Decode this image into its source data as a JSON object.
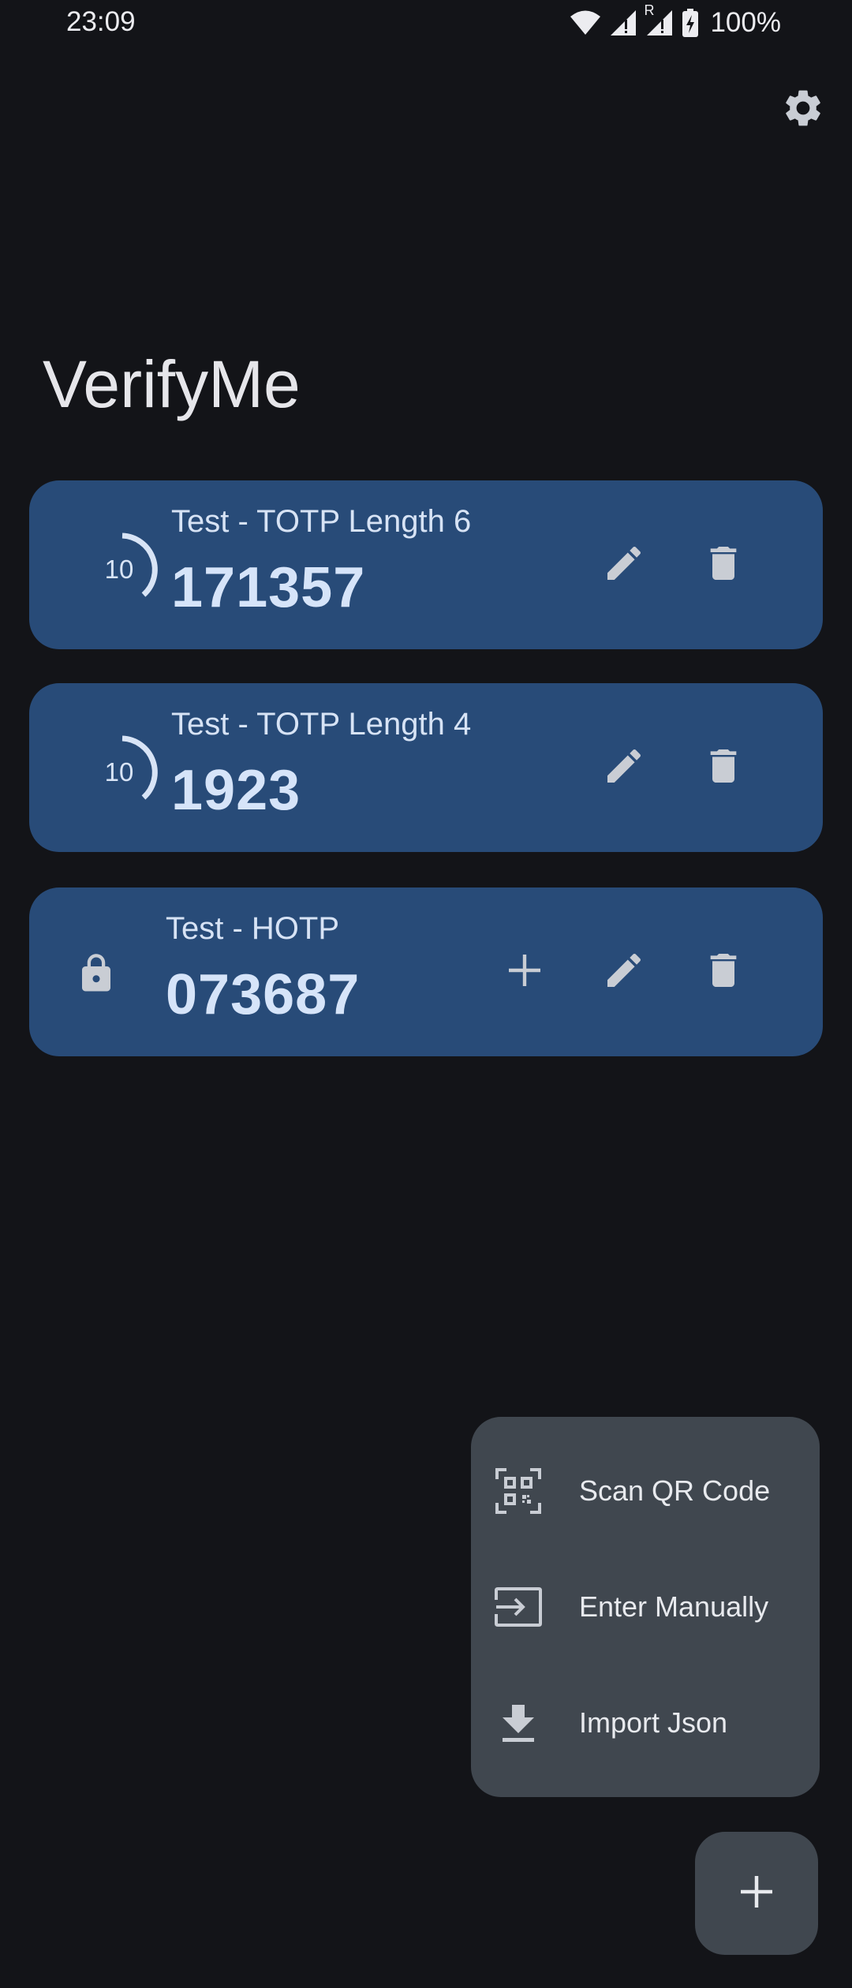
{
  "status_bar": {
    "time": "23:09",
    "battery": "100%",
    "roaming_indicator": "R"
  },
  "app": {
    "title": "VerifyMe"
  },
  "accounts": [
    {
      "name": "Test - TOTP Length 6",
      "code": "171357",
      "type": "TOTP",
      "seconds_remaining": "10"
    },
    {
      "name": "Test - TOTP Length 4",
      "code": "1923",
      "type": "TOTP",
      "seconds_remaining": "10"
    },
    {
      "name": "Test - HOTP",
      "code": "073687",
      "type": "HOTP"
    }
  ],
  "add_menu": {
    "items": [
      {
        "label": "Scan QR Code",
        "icon": "qr-scan-icon"
      },
      {
        "label": "Enter Manually",
        "icon": "login-arrow-icon"
      },
      {
        "label": "Import Json",
        "icon": "download-icon"
      }
    ]
  },
  "icons": {
    "settings": "gear-icon",
    "edit": "pencil-icon",
    "delete": "trash-icon",
    "lock": "lock-icon",
    "increment": "plus-icon",
    "fab": "plus-icon"
  },
  "colors": {
    "background": "#131418",
    "card": "#284b78",
    "menu": "#40474f",
    "code_text": "#d6e4f9",
    "icon": "#c9cdd4"
  }
}
